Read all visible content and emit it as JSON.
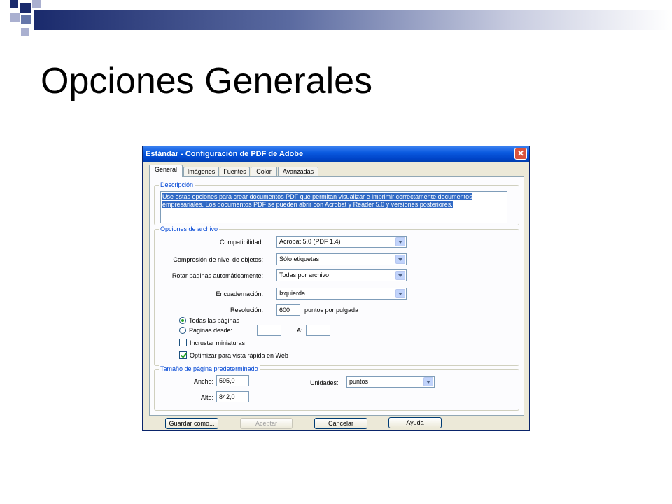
{
  "slide": {
    "title": "Opciones Generales",
    "accent_colors": {
      "dark_blue": "#1a2a6c",
      "mid_blue": "#6677aa",
      "light_blue": "#aab0d0"
    }
  },
  "dialog": {
    "title": "Estándar - Configuración de PDF de Adobe",
    "close_icon": "close-icon",
    "tabs": [
      {
        "label": "General",
        "active": true
      },
      {
        "label": "Imágenes",
        "active": false
      },
      {
        "label": "Fuentes",
        "active": false
      },
      {
        "label": "Color",
        "active": false
      },
      {
        "label": "Avanzadas",
        "active": false
      }
    ],
    "description": {
      "group_label": "Descripción",
      "text": "Use estas opciones para crear documentos PDF que permitan visualizar e imprimir correctamente documentos empresariales. Los documentos PDF se pueden abrir con Acrobat y Reader 5.0 y versiones posteriores."
    },
    "file_options": {
      "group_label": "Opciones de archivo",
      "compatibility_label": "Compatibilidad:",
      "compatibility_value": "Acrobat 5.0 (PDF 1.4)",
      "compression_label": "Compresión de nivel de objetos:",
      "compression_value": "Sólo etiquetas",
      "rotate_label": "Rotar páginas automáticamente:",
      "rotate_value": "Todas por archivo",
      "binding_label": "Encuadernación:",
      "binding_value": "Izquierda",
      "resolution_label": "Resolución:",
      "resolution_value": "600",
      "resolution_unit": "puntos por pulgada",
      "all_pages_label": "Todas las páginas",
      "all_pages_selected": true,
      "pages_from_label": "Páginas desde:",
      "pages_from_value": "",
      "pages_to_label": "A:",
      "pages_to_value": "",
      "embed_thumbnails_label": "Incrustar miniaturas",
      "embed_thumbnails_checked": false,
      "optimize_label": "Optimizar para vista rápida en Web",
      "optimize_checked": true
    },
    "page_size": {
      "group_label": "Tamaño de página predeterminado",
      "width_label": "Ancho:",
      "width_value": "595,0",
      "height_label": "Alto:",
      "height_value": "842,0",
      "units_label": "Unidades:",
      "units_value": "puntos"
    },
    "buttons": {
      "save_as": "Guardar como...",
      "accept": "Aceptar",
      "cancel": "Cancelar",
      "help": "Ayuda"
    }
  }
}
